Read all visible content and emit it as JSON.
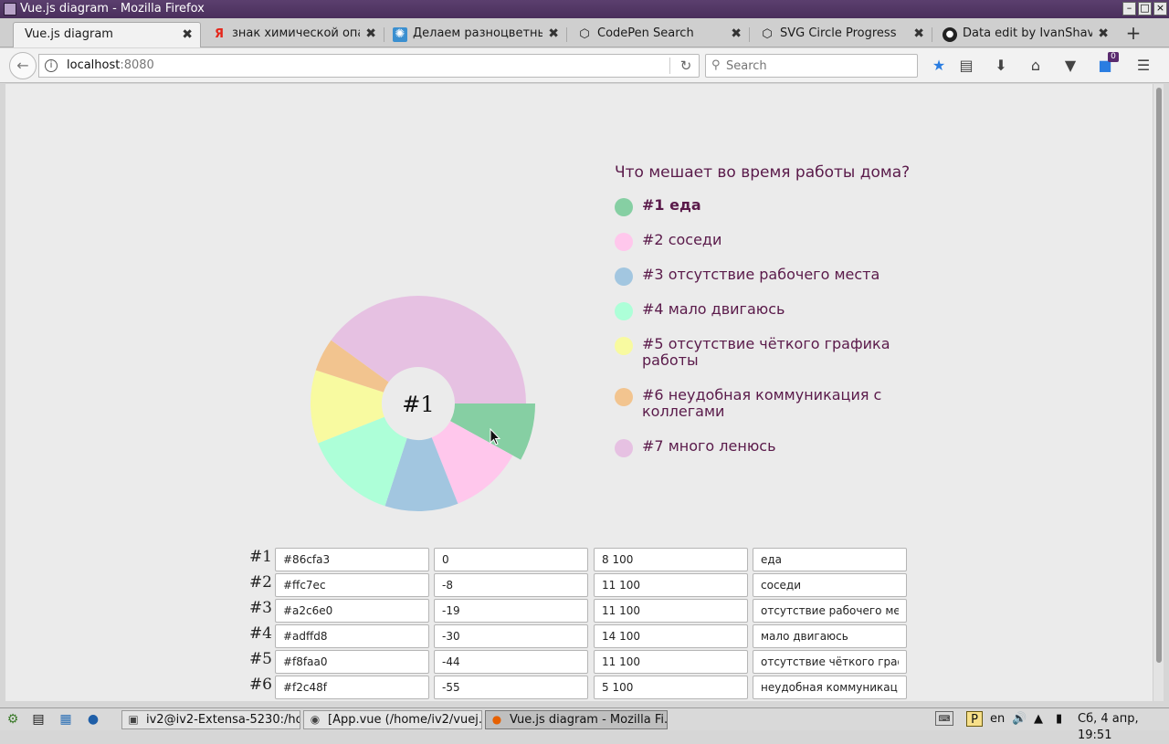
{
  "window": {
    "title": "Vue.js diagram - Mozilla Firefox"
  },
  "tabs": [
    {
      "label": "Vue.js diagram",
      "icon": "none",
      "active": true
    },
    {
      "label": "знак химической опа...",
      "icon": "yandex-icon"
    },
    {
      "label": "Делаем разноцветны...",
      "icon": "gear-favicon"
    },
    {
      "label": "CodePen Search",
      "icon": "codepen-icon"
    },
    {
      "label": "SVG Circle Progress",
      "icon": "codepen-icon"
    },
    {
      "label": "Data edit by IvanShavli...",
      "icon": "github-icon"
    }
  ],
  "navbar": {
    "url_host": "localhost",
    "url_port": ":8080",
    "search_placeholder": "Search",
    "pocket_badge": "0"
  },
  "diagram": {
    "center_label": "#1",
    "title": "Что мешает во время работы дома?",
    "selected": 0
  },
  "items": [
    {
      "id": "#1",
      "color": "#86cfa3",
      "offset": "0",
      "value": "8 100",
      "label": "еда"
    },
    {
      "id": "#2",
      "color": "#ffc7ec",
      "offset": "-8",
      "value": "11 100",
      "label": "соседи"
    },
    {
      "id": "#3",
      "color": "#a2c6e0",
      "offset": "-19",
      "value": "11 100",
      "label": "отсутствие рабочего места"
    },
    {
      "id": "#4",
      "color": "#adffd8",
      "offset": "-30",
      "value": "14 100",
      "label": "мало двигаюсь"
    },
    {
      "id": "#5",
      "color": "#f8faa0",
      "offset": "-44",
      "value": "11 100",
      "label": "отсутствие чёткого графика работы"
    },
    {
      "id": "#6",
      "color": "#f2c48f",
      "offset": "-55",
      "value": "5 100",
      "label": "неудобная коммуникация с коллегами"
    },
    {
      "id": "#7",
      "color": "#e6c1e2",
      "label": "много ленюсь"
    }
  ],
  "taskbar": {
    "tasks": [
      {
        "label": "iv2@iv2-Extensa-5230:/ho...",
        "icon": "terminal-icon"
      },
      {
        "label": "[App.vue (/home/iv2/vuej...",
        "icon": "editor-icon"
      },
      {
        "label": "Vue.js diagram - Mozilla Fi...",
        "icon": "firefox-icon",
        "active": true
      }
    ],
    "lang": "en",
    "clock": "Сб, 4 апр, 19:51"
  }
}
